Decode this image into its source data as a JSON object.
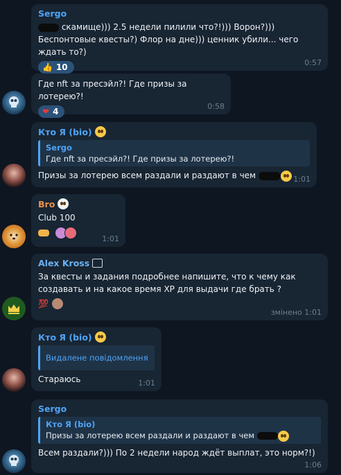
{
  "messages": [
    {
      "sender": "Sergo",
      "text": "скамище))) 2.5 недели пилили что?!))) Ворон?))) Беспонтовые квесты?) Флор на дне))) ценник убили... чего ждать то?)",
      "reaction_emoji": "👍",
      "reaction_count": "10",
      "time": "0:57"
    },
    {
      "text": "Где nft за пресэйл?! Где призы за лотерею?!",
      "reaction_emoji": "❤",
      "reaction_count": "4",
      "time": "0:58"
    },
    {
      "sender": "Кто Я (bio)",
      "quote_name": "Sergo",
      "quote_text": "Где nft за пресэйл?! Где призы за лотерею?!",
      "text": "Призы за лотерею всем раздали и раздают в чем",
      "time": "1:01"
    },
    {
      "sender": "Bro",
      "text": "Club 100",
      "time": "1:01"
    },
    {
      "sender": "Alex Kross",
      "text": "За квесты и задания подробнее напишите, что к чему как создавать и на какое время XP для выдачи где брать ?",
      "reaction_emoji": "💯",
      "time": "змінено 1:01"
    },
    {
      "sender": "Кто Я (bio)",
      "quote_text": "Видалене повідомлення",
      "text": "Стараюсь",
      "time": "1:01"
    },
    {
      "sender": "Sergo",
      "quote_name": "Кто Я (bio)",
      "quote_text": "Призы за лотерею всем раздали и раздают в чем",
      "text": "Всем раздали?))) По 2 недели народ ждёт выплат, это норм?!)",
      "time": "1:06"
    }
  ],
  "colors": {
    "background": "#0e1621",
    "bubble": "#182533",
    "sergo": "#4ea4f6",
    "bro": "#e8924d",
    "alex": "#6ab2f2",
    "reaction": "#2b5278"
  }
}
